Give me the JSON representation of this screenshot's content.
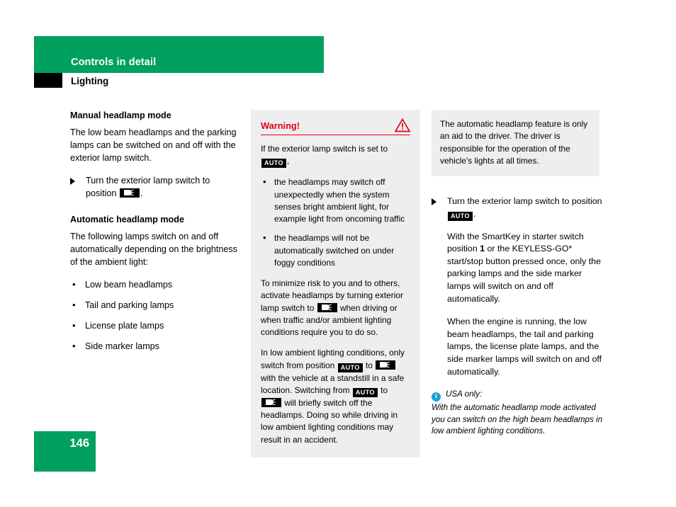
{
  "header": {
    "chapter_title": "Controls in detail",
    "section_title": "Lighting"
  },
  "left_column": {
    "manual_heading": "Manual headlamp mode",
    "manual_paragraph": "The low beam headlamps and the parking lamps can be switched on and off with the exterior lamp switch.",
    "manual_step_prefix": "Turn the exterior lamp switch to position",
    "manual_step_suffix": ".",
    "automatic_heading": "Automatic headlamp mode",
    "automatic_paragraph": "The following lamps switch on and off automatically depending on the brightness of the ambient light:",
    "lamp_list": [
      "Low beam headlamps",
      "Tail and parking lamps",
      "License plate lamps",
      "Side marker lamps"
    ]
  },
  "warning_box": {
    "title": "Warning!",
    "icon": "warning-triangle-icon",
    "accent_color": "#e2001a",
    "intro_prefix": "If the exterior lamp switch is set to",
    "intro_suffix": ",",
    "bullets": [
      "the headlamps may switch off unexpectedly when the system senses bright ambient light, for example light from oncoming traffic",
      "the headlamps will not be automatically switched on under foggy conditions"
    ],
    "para2_part1": "To minimize risk to you and to others, activate headlamps by turning exterior lamp switch to",
    "para2_part2": "when driving or when traffic and/or ambient lighting conditions require you to do so.",
    "para3_part1": "In low ambient lighting conditions, only switch from position",
    "para3_part2": "to",
    "para3_part3": "with the vehicle at a standstill in a safe location. Switching from",
    "para3_part4": "to",
    "para3_part5": "will briefly switch off the headlamps. Doing so while driving in low ambient lighting conditions may result in an accident."
  },
  "right_column": {
    "note_box": "The automatic headlamp feature is only an aid to the driver. The driver is responsible for the operation of the vehicle's lights at all times.",
    "step_prefix": "Turn the exterior lamp switch to position",
    "step_suffix": ".",
    "paragraph_1_part1": "With the SmartKey in starter switch position",
    "paragraph_1_bold": "1",
    "paragraph_1_part2": "or the KEYLESS-GO* start/stop button pressed once, only the parking lamps and the side marker lamps will switch on and off automatically.",
    "paragraph_2": "When the engine is running, the low beam headlamps, the tail and parking lamps, the license plate lamps, and the side marker lamps will switch on and off automatically.",
    "usa_note_heading": "USA only:",
    "usa_note_body": "With the automatic headlamp mode activated you can switch on the high beam headlamps in low ambient lighting conditions.",
    "info_icon": "info-circle-icon"
  },
  "badges": {
    "auto_label": "AUTO",
    "lowbeam_label": "low-beam-symbol"
  },
  "footer": {
    "page_number": "146",
    "brand_color": "#00a05e"
  }
}
